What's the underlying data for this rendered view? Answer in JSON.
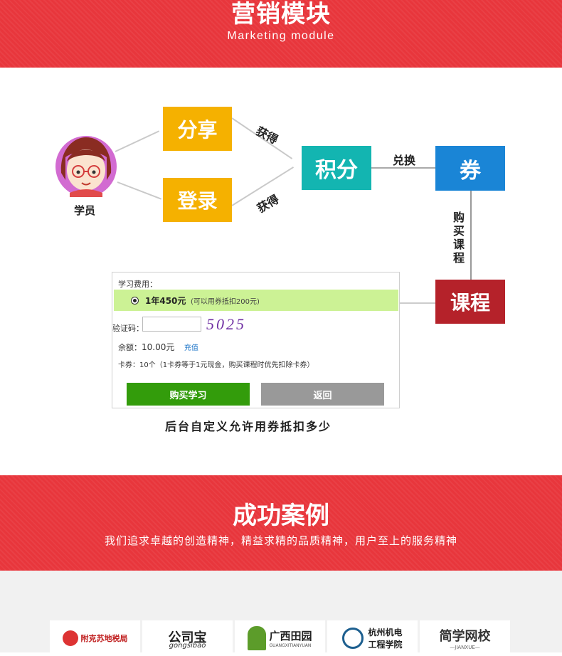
{
  "header": {
    "title_zh": "营销模块",
    "title_en": "Marketing module"
  },
  "diagram": {
    "student_label": "学员",
    "share": "分享",
    "login": "登录",
    "points": "积分",
    "coupon": "券",
    "course": "课程",
    "earn_top": "获得",
    "earn_bottom": "获得",
    "exchange": "兑换",
    "buy_course": "购买课程",
    "caption": "后台自定义允许用券抵扣多少",
    "colors": {
      "orange": "#f5b100",
      "teal": "#13b5b1",
      "blue": "#1a85d6",
      "darkred": "#b5222a"
    }
  },
  "payment": {
    "fee_label": "学习费用：",
    "plan": "1年450元",
    "plan_note": "(可以用券抵扣200元)",
    "captcha_label": "验证码：",
    "captcha_input_value": "",
    "captcha_code": "5025",
    "balance_label": "余额：",
    "balance_value": "10.00元",
    "recharge_link": "充值",
    "coupon_line": "卡券：10个（1卡券等于1元现金，购买课程时优先扣除卡券）",
    "buy_button": "购买学习",
    "back_button": "返回",
    "colors": {
      "highlight": "#ccf295",
      "buy": "#339c0b",
      "back": "#999999",
      "link": "#1a73c7"
    }
  },
  "success": {
    "title": "成功案例",
    "subtitle": "我们追求卓越的创造精神，精益求精的品质精神，用户至上的服务精神"
  },
  "logos": [
    {
      "name": "附克苏地税局"
    },
    {
      "name": "公司宝",
      "sub": "gongsibao"
    },
    {
      "name": "广西田园",
      "sub": "GUANGXITIANYUAN"
    },
    {
      "name": "杭州机电",
      "sub": "工程学院"
    },
    {
      "name": "简学网校",
      "sub": "—JIANXUE—"
    }
  ],
  "theme": {
    "brand_red": "#e8363c"
  }
}
